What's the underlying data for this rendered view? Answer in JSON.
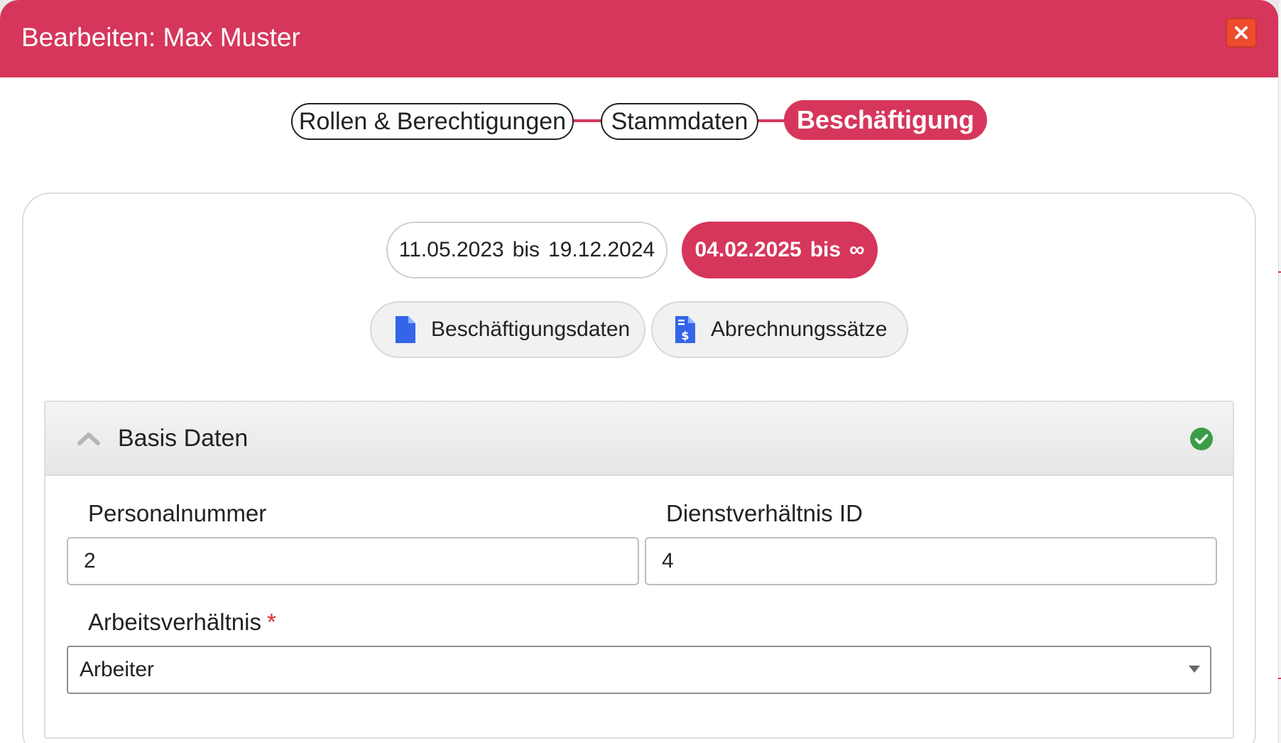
{
  "modal": {
    "title": "Bearbeiten: Max Muster",
    "close_icon": "close-icon",
    "header_color": "#d6365b"
  },
  "stepper": {
    "steps": [
      {
        "label": "Rollen & Berechtigungen",
        "active": false
      },
      {
        "label": "Stammdaten",
        "active": false
      },
      {
        "label": "Beschäftigung",
        "active": true
      }
    ]
  },
  "periods": [
    {
      "from": "11.05.2023",
      "sep": "bis",
      "to": "19.12.2024",
      "active": false
    },
    {
      "from": "04.02.2025",
      "sep": "bis",
      "to": "∞",
      "active": true
    }
  ],
  "subtabs": [
    {
      "label": "Beschäftigungsdaten",
      "icon": "file-icon"
    },
    {
      "label": "Abrechnungssätze",
      "icon": "file-invoice-dollar-icon"
    }
  ],
  "section": {
    "title": "Basis Daten",
    "expanded": true,
    "status_icon": "check-circle-icon",
    "status_color": "#3a9d46",
    "fields": {
      "personalnummer": {
        "label": "Personalnummer",
        "value": "2"
      },
      "dienstverhaeltnis_id": {
        "label": "Dienstverhältnis ID",
        "value": "4"
      },
      "arbeitsverhaeltnis": {
        "label": "Arbeitsverhältnis",
        "required_mark": "*",
        "value": "Arbeiter"
      }
    }
  },
  "colors": {
    "accent": "#d6365b",
    "close_button": "#ee4b2f",
    "icon_blue": "#3465e8"
  }
}
